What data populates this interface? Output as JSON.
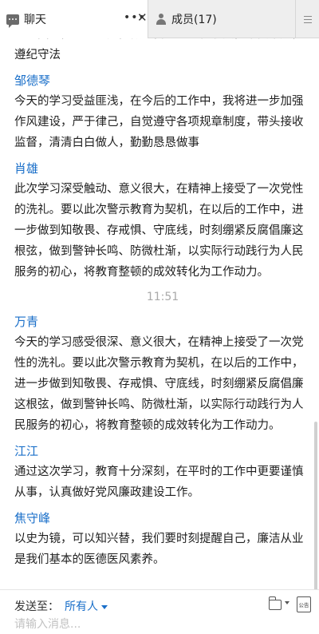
{
  "tabs": {
    "chat_label": "聊天",
    "members_label": "成员(17)"
  },
  "messages": [
    {
      "sender": "",
      "text": "忠于国家，忠于人民，做好自己的岗位职责，不贪不腐，遵纪守法"
    },
    {
      "sender": "邹德琴",
      "text": "今天的学习受益匪浅，在今后的工作中，我将进一步加强作风建设，严于律己，自觉遵守各项规章制度，带头接收监督，清清白白做人，勤勤恳恳做事"
    },
    {
      "sender": "肖雄",
      "text": "此次学习深受触动、意义很大，在精神上接受了一次党性的洗礼。要以此次警示教育为契机，在以后的工作中，进一步做到知敬畏、存戒惧、守底线，时刻绷紧反腐倡廉这根弦，做到警钟长鸣、防微杜渐，以实际行动践行为人民服务的初心，将教育整顿的成效转化为工作动力。"
    },
    {
      "time": "11:51"
    },
    {
      "sender": "万青",
      "text": "今天的学习感受很深、意义很大，在精神上接受了一次党性的洗礼。要以此次警示教育为契机，在以后的工作中，进一步做到知敬畏、存戒惧、守底线，时刻绷紧反腐倡廉这根弦，做到警钟长鸣、防微杜渐，以实际行动践行为人民服务的初心，将教育整顿的成效转化为工作动力。"
    },
    {
      "sender": "江江",
      "text": "通过这次学习，教育十分深刻，在平时的工作中更要谨慎从事，认真做好党风廉政建设工作。"
    },
    {
      "sender": "焦守峰",
      "text": "以史为镜，可以知兴替，我们要时刻提醒自己，廉洁从业是我们基本的医德医风素养。"
    }
  ],
  "composer": {
    "send_to_label": "发送至：",
    "recipient": "所有人",
    "input_placeholder": "请输入消息...",
    "notice_icon_text": "公告"
  },
  "colors": {
    "accent": "#1a6fc9",
    "tab_bar_bg": "#eeeeee"
  },
  "icons": {
    "chat": "chat-bubble-icon",
    "members": "person-icon",
    "more": "more-dots-icon",
    "close": "close-icon",
    "menu": "menu-icon",
    "folder": "folder-icon",
    "notice": "notice-icon"
  }
}
